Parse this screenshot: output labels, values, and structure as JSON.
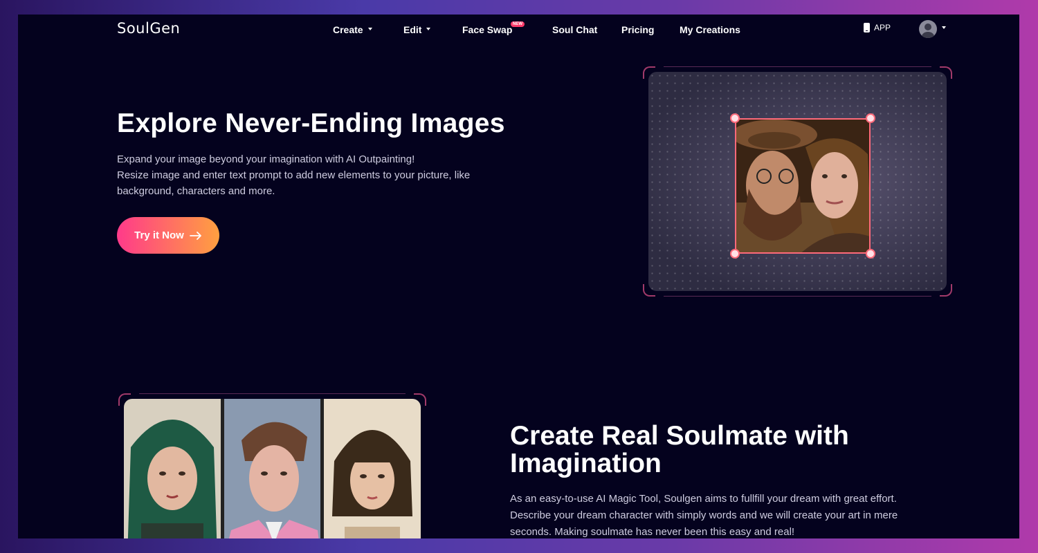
{
  "brand": {
    "logo": "SoulGen"
  },
  "nav": {
    "items": [
      {
        "label": "Create",
        "has_dropdown": true
      },
      {
        "label": "Edit",
        "has_dropdown": true
      },
      {
        "label": "Face Swap",
        "badge": "NEW"
      },
      {
        "label": "Soul Chat"
      },
      {
        "label": "Pricing"
      },
      {
        "label": "My Creations"
      }
    ],
    "app_label": "APP"
  },
  "hero": {
    "title": "Explore Never-Ending Images",
    "desc_line1": "Expand your image beyond your imagination with AI Outpainting!",
    "desc_line2": "Resize image and enter text prompt to add new elements to your picture, like background, characters and more.",
    "cta_label": "Try it Now"
  },
  "section2": {
    "title": "Create Real Soulmate with Imagination",
    "desc": "As an easy-to-use AI Magic Tool, Soulgen aims to fullfill your dream with great effort. Describe your dream character with simply words and we will create your art in mere seconds. Making soulmate has never been this easy and real!"
  },
  "colors": {
    "background": "#04021e",
    "cta_gradient_start": "#ff3a8a",
    "cta_gradient_end": "#ffa040",
    "accent_border": "#ff6a7a",
    "badge": "#ff3a6a"
  },
  "icons": {
    "dropdown": "caret-down-icon",
    "app": "phone-icon",
    "avatar": "user-avatar-icon",
    "cta": "arrow-right-icon"
  }
}
